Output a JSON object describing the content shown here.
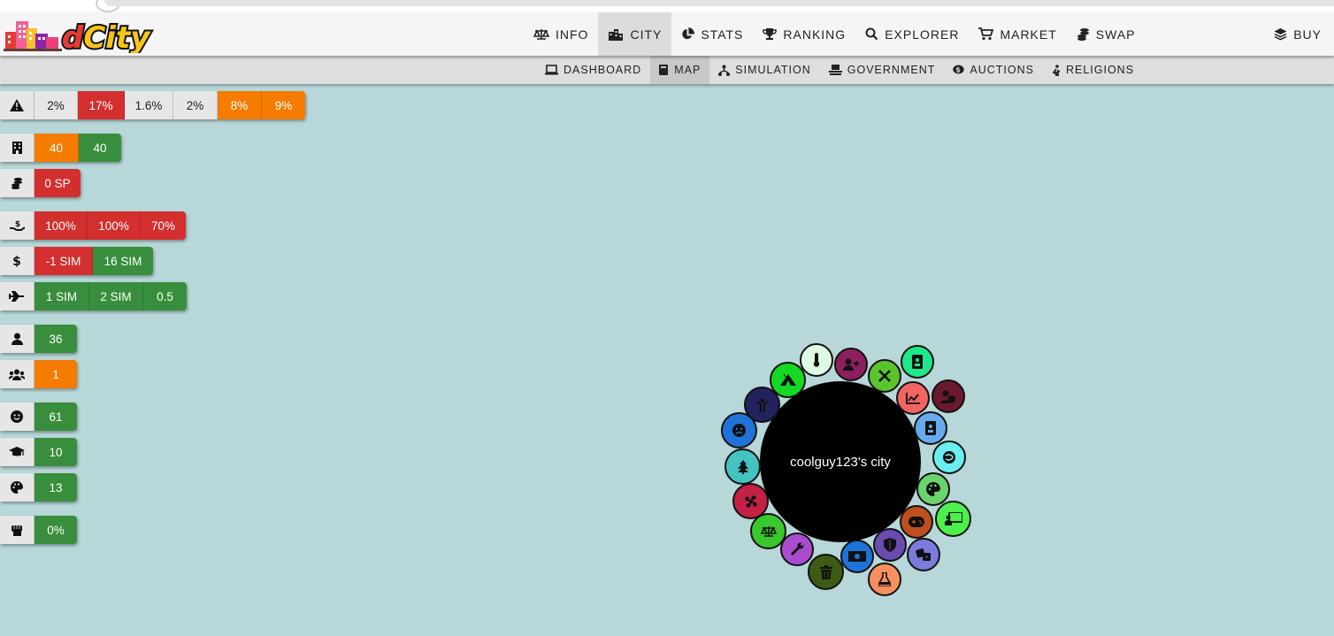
{
  "app": {
    "logo_text": "dCity"
  },
  "nav": {
    "items": [
      {
        "label": "INFO",
        "icon": "balance-scale-icon"
      },
      {
        "label": "CITY",
        "icon": "city-icon",
        "active": true
      },
      {
        "label": "STATS",
        "icon": "pie-chart-icon"
      },
      {
        "label": "RANKING",
        "icon": "trophy-icon"
      },
      {
        "label": "EXPLORER",
        "icon": "search-icon"
      },
      {
        "label": "MARKET",
        "icon": "cart-icon"
      },
      {
        "label": "SWAP",
        "icon": "coins-icon"
      }
    ],
    "buy": {
      "label": "BUY",
      "icon": "layers-icon"
    }
  },
  "subnav": {
    "items": [
      {
        "label": "DASHBOARD",
        "icon": "laptop-icon"
      },
      {
        "label": "MAP",
        "icon": "book-icon",
        "active": true
      },
      {
        "label": "SIMULATION",
        "icon": "network-icon"
      },
      {
        "label": "GOVERNMENT",
        "icon": "podium-icon"
      },
      {
        "label": "AUCTIONS",
        "icon": "comment-dollar-icon"
      },
      {
        "label": "RELIGIONS",
        "icon": "praying-icon"
      }
    ]
  },
  "stats": {
    "warning": {
      "icon": "warning-icon",
      "values": [
        "2%",
        "17%",
        "1.6%",
        "2%",
        "8%",
        "9%"
      ],
      "colors": [
        "gray",
        "red",
        "gray",
        "gray",
        "orange",
        "orange"
      ]
    },
    "buildings": {
      "icon": "building-icon",
      "values": [
        "40",
        "40"
      ],
      "colors": [
        "orange",
        "green"
      ]
    },
    "coins": {
      "icon": "coins-icon",
      "values": [
        "0 SP"
      ],
      "colors": [
        "red"
      ]
    },
    "hand": {
      "icon": "hand-holding-dollar-icon",
      "values": [
        "100%",
        "100%",
        "70%"
      ],
      "colors": [
        "red",
        "red",
        "red"
      ]
    },
    "dollar": {
      "icon": "dollar-icon",
      "values": [
        "-1 SIM",
        "16 SIM"
      ],
      "colors": [
        "red",
        "green"
      ]
    },
    "plane": {
      "icon": "plane-icon",
      "values": [
        "1 SIM",
        "2 SIM",
        "0.5"
      ],
      "colors": [
        "green",
        "green",
        "green"
      ]
    },
    "user": {
      "icon": "user-icon",
      "values": [
        "36"
      ],
      "colors": [
        "green"
      ]
    },
    "users": {
      "icon": "users-icon",
      "values": [
        "1"
      ],
      "colors": [
        "orange"
      ]
    },
    "smile": {
      "icon": "smile-icon",
      "values": [
        "61"
      ],
      "colors": [
        "green"
      ]
    },
    "education": {
      "icon": "graduation-cap-icon",
      "values": [
        "10"
      ],
      "colors": [
        "green"
      ]
    },
    "culture": {
      "icon": "palette-icon",
      "values": [
        "13"
      ],
      "colors": [
        "green"
      ]
    },
    "fist": {
      "icon": "fist-icon",
      "values": [
        "0%"
      ],
      "colors": [
        "green"
      ]
    }
  },
  "map": {
    "city_name": "coolguy123's city",
    "buildings": [
      {
        "name": "thermometer-building",
        "color": "#e0fbe4"
      },
      {
        "name": "user-plus-building",
        "color": "#8e1f5e"
      },
      {
        "name": "tools-building",
        "color": "#5ac42f"
      },
      {
        "name": "id-badge-building",
        "color": "#1ee98a"
      },
      {
        "name": "user-shield-building",
        "color": "#6a1a2e"
      },
      {
        "name": "chart-line-building",
        "color": "#f26363"
      },
      {
        "name": "id-card-building",
        "color": "#66aaf0"
      },
      {
        "name": "hospital-building",
        "color": "#68f0f0"
      },
      {
        "name": "palette-building",
        "color": "#6cd46c"
      },
      {
        "name": "chalkboard-building",
        "color": "#4cf04c"
      },
      {
        "name": "gamepad-building",
        "color": "#bf4f1f"
      },
      {
        "name": "dice-building",
        "color": "#7b7bdb"
      },
      {
        "name": "shield-building",
        "color": "#6a4bb0"
      },
      {
        "name": "money-building",
        "color": "#1c73d8"
      },
      {
        "name": "flask-building",
        "color": "#f7905e"
      },
      {
        "name": "trash-building",
        "color": "#3d5b12"
      },
      {
        "name": "wrench-building",
        "color": "#a94ccf"
      },
      {
        "name": "balance-building",
        "color": "#38c82c"
      },
      {
        "name": "fan-building",
        "color": "#c52045"
      },
      {
        "name": "tree-building",
        "color": "#44c3c3"
      },
      {
        "name": "frown-building",
        "color": "#1f73d8"
      },
      {
        "name": "child-building",
        "color": "#22235e"
      },
      {
        "name": "campground-building",
        "color": "#14d924"
      }
    ]
  }
}
